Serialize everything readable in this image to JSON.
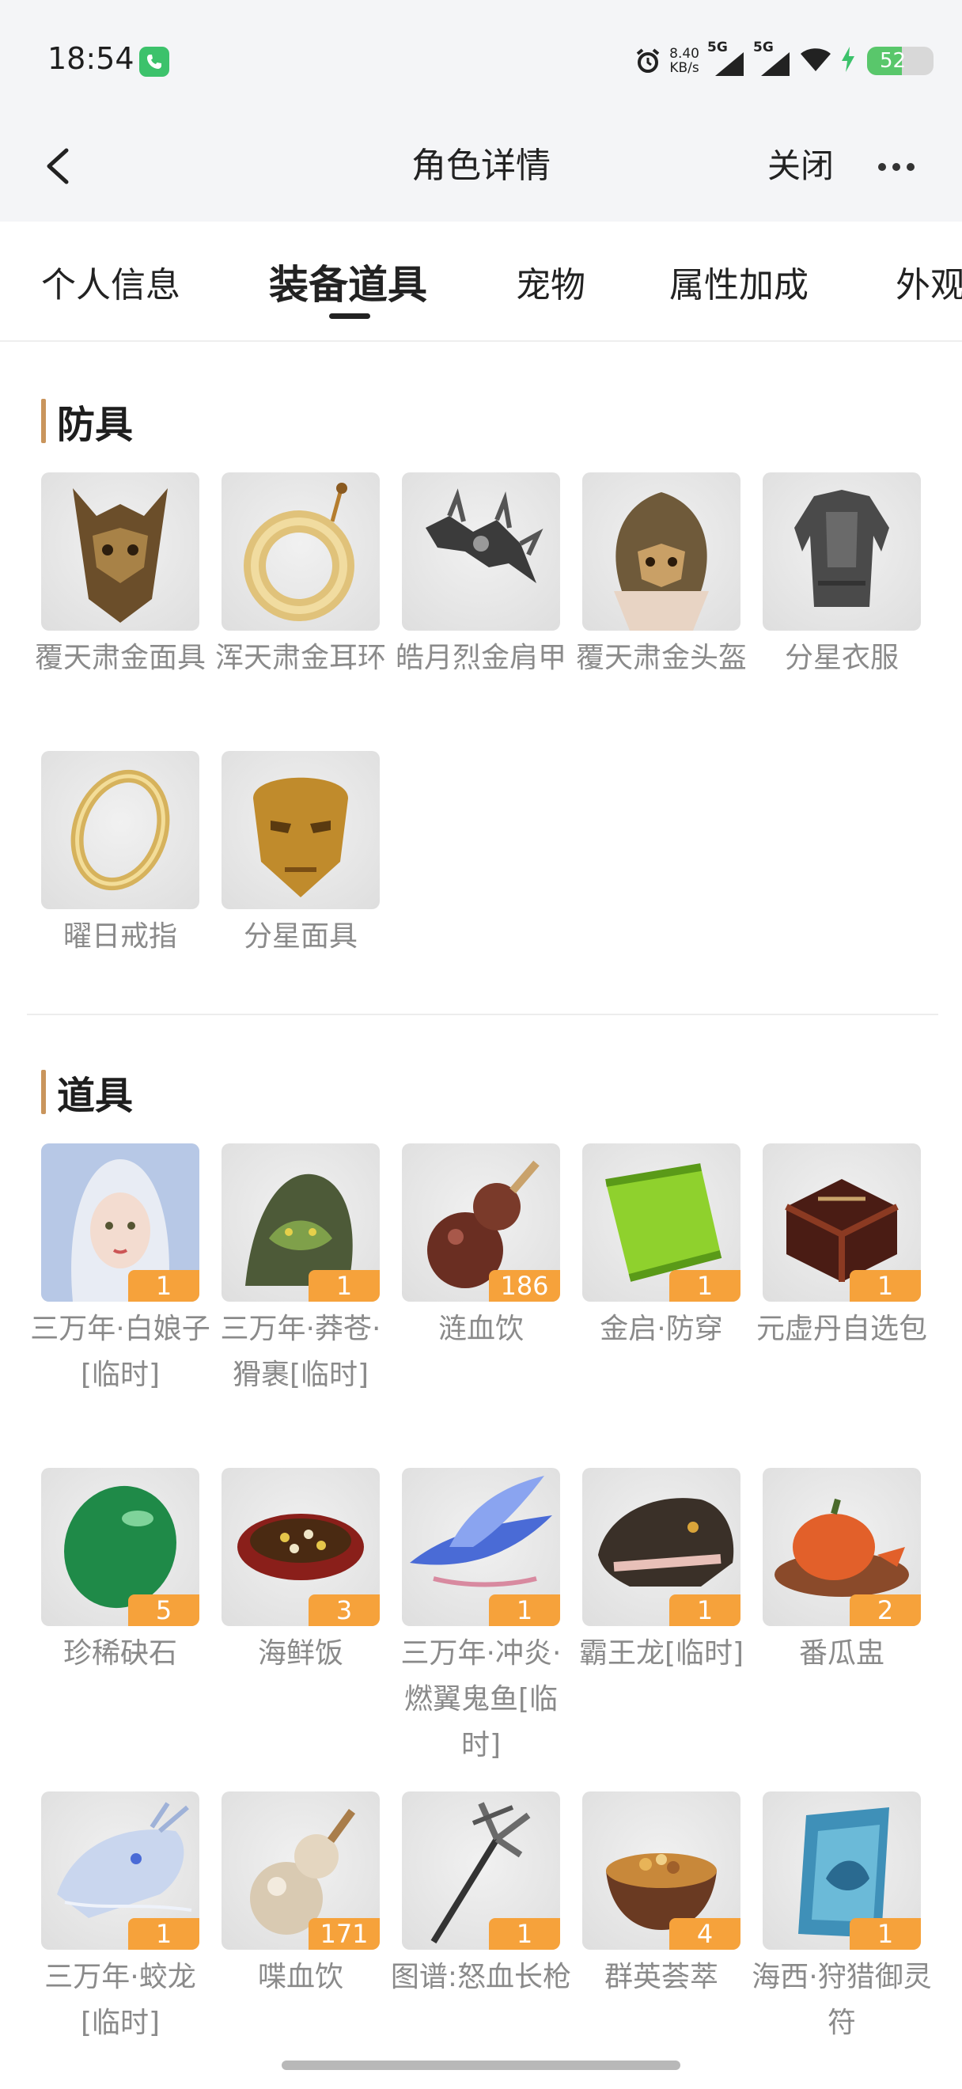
{
  "status_bar": {
    "time": "18:54",
    "net_speed_value": "8.40",
    "net_speed_unit": "KB/s",
    "signal_1": "5G",
    "signal_2": "5G",
    "battery": "52",
    "icons": [
      "call-icon",
      "alarm-icon",
      "signal-icon",
      "wifi-icon",
      "charging-icon",
      "battery-icon"
    ]
  },
  "header": {
    "title": "角色详情",
    "close_label": "关闭"
  },
  "tabs": [
    {
      "label": "个人信息"
    },
    {
      "label": "装备道具",
      "active": true
    },
    {
      "label": "宠物"
    },
    {
      "label": "属性加成"
    },
    {
      "label": "外观"
    }
  ],
  "armor": {
    "title": "防具",
    "items": [
      {
        "name": "覆天肃金面具",
        "icon": "bronze-mask-icon"
      },
      {
        "name": "浑天肃金耳环",
        "icon": "jade-ring-earring-icon"
      },
      {
        "name": "皓月烈金肩甲",
        "icon": "spiked-shoulder-icon"
      },
      {
        "name": "覆天肃金头盔",
        "icon": "bronze-helmet-icon"
      },
      {
        "name": "分星衣服",
        "icon": "dark-armor-icon"
      },
      {
        "name": "曜日戒指",
        "icon": "gold-ring-icon"
      },
      {
        "name": "分星面具",
        "icon": "gold-mask-icon"
      }
    ]
  },
  "props": {
    "title": "道具",
    "items": [
      {
        "name": "三万年·白娘子[临时]",
        "qty": "1",
        "icon": "white-lady-portrait-icon"
      },
      {
        "name": "三万年·莽苍·猾裹[临时]",
        "qty": "1",
        "icon": "beast-icon"
      },
      {
        "name": "涟血饮",
        "qty": "186",
        "icon": "dark-gourd-icon"
      },
      {
        "name": "金启·防穿",
        "qty": "1",
        "icon": "green-scroll-icon"
      },
      {
        "name": "元虚丹自选包",
        "qty": "1",
        "icon": "lacquer-box-icon"
      },
      {
        "name": "珍稀砄石",
        "qty": "5",
        "icon": "green-stone-icon"
      },
      {
        "name": "海鲜饭",
        "qty": "3",
        "icon": "seafood-rice-icon"
      },
      {
        "name": "三万年·冲炎·燃翼鬼鱼[临时]",
        "qty": "1",
        "icon": "winged-fish-icon"
      },
      {
        "name": "霸王龙[临时]",
        "qty": "1",
        "icon": "trex-icon"
      },
      {
        "name": "番瓜盅",
        "qty": "2",
        "icon": "pumpkin-bowl-icon"
      },
      {
        "name": "三万年·蛟龙[临时]",
        "qty": "1",
        "icon": "dragon-icon"
      },
      {
        "name": "喋血饮",
        "qty": "171",
        "icon": "pale-gourd-icon"
      },
      {
        "name": "图谱:怒血长枪",
        "qty": "1",
        "icon": "trident-spear-icon"
      },
      {
        "name": "群英荟萃",
        "qty": "4",
        "icon": "food-bowl-icon"
      },
      {
        "name": "海西·狩猎御灵符",
        "qty": "1",
        "icon": "blue-card-icon"
      }
    ]
  },
  "colors": {
    "accent_bar": "#c9955c",
    "qty_badge": "#f6a23b",
    "item_label": "#8a8a8a",
    "header_bg": "#f4f5f7"
  }
}
